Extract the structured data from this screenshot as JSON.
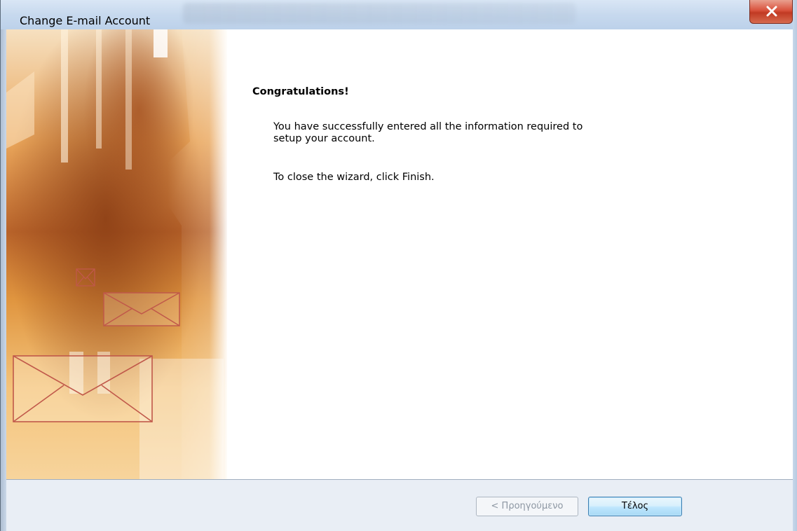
{
  "window": {
    "title": "Change E-mail Account"
  },
  "content": {
    "heading": "Congratulations!",
    "message": "You have successfully entered all the information required to setup your account.",
    "instruction": "To close the wizard, click Finish."
  },
  "footer": {
    "back_label": "< Προηγούμενο",
    "finish_label": "Τέλος"
  },
  "icons": {
    "close": "close-icon",
    "envelope": "envelope-icon"
  },
  "colors": {
    "banner_dark": "#b05a1e",
    "banner_light": "#f3c27a",
    "envelope_stroke": "#c0584a",
    "close_button": "#d9523c",
    "primary_button_border": "#3c7fb1"
  }
}
